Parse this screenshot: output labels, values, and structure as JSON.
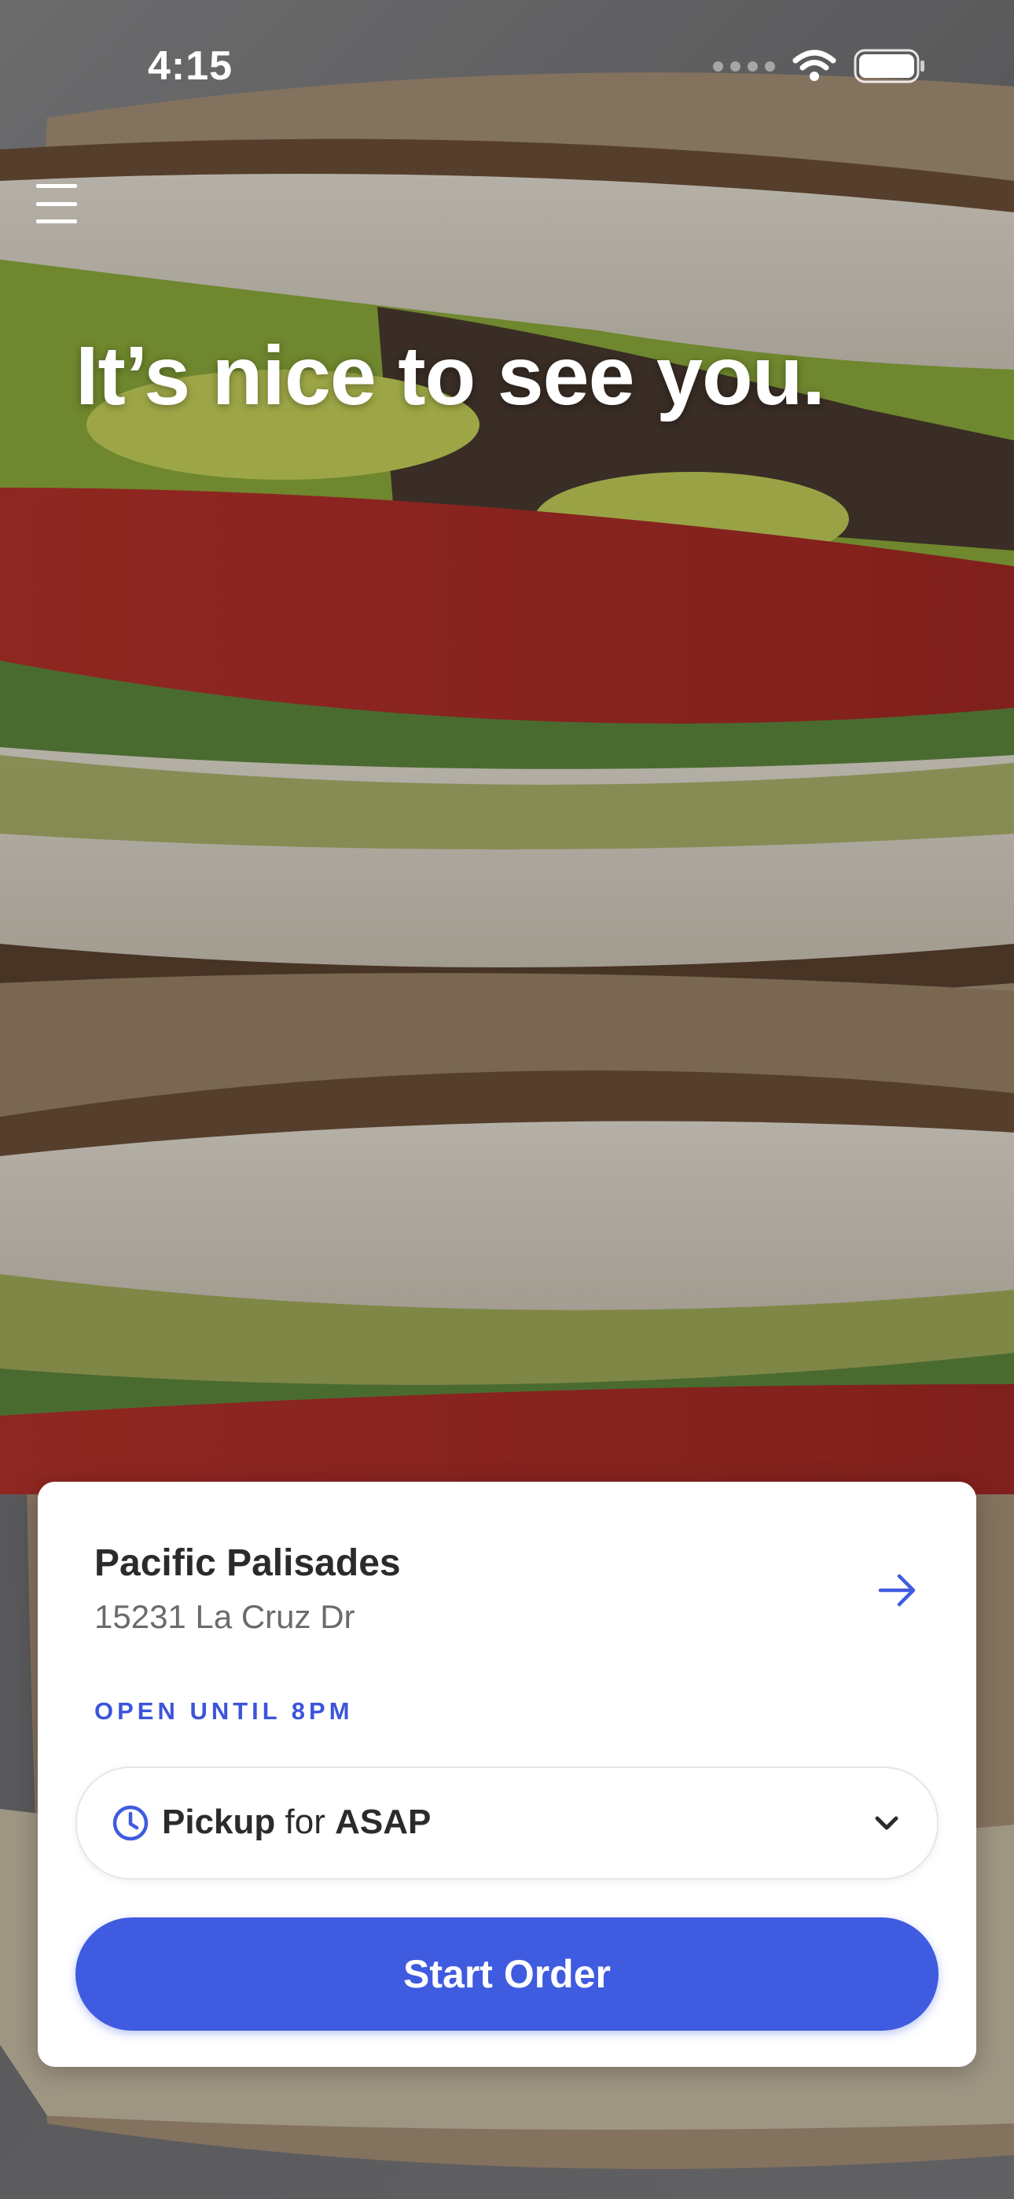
{
  "status_bar": {
    "time": "4:15",
    "icons": [
      "cellular-signal-icon",
      "wifi-icon",
      "battery-icon"
    ]
  },
  "header": {
    "menu_icon": "hamburger-menu-icon",
    "greeting": "It’s nice to see you."
  },
  "location_card": {
    "name": "Pacific Palisades",
    "address": "15231 La Cruz Dr",
    "hours_status": "OPEN UNTIL 8PM",
    "details_icon": "arrow-right-icon"
  },
  "order_mode": {
    "mode": "Pickup",
    "connector": "for",
    "time": "ASAP",
    "icon": "clock-icon",
    "dropdown_icon": "chevron-down-icon"
  },
  "primary_action": {
    "label": "Start Order"
  },
  "colors": {
    "accent": "#3f5be0",
    "text_dark": "#2b2b2b",
    "text_muted": "#6b6b6b",
    "card_background": "#ffffff"
  }
}
